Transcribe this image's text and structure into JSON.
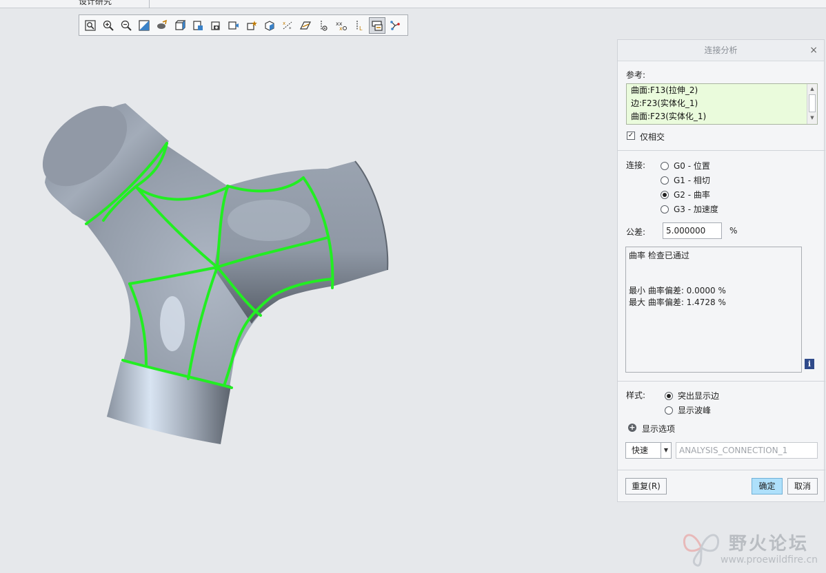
{
  "top_tab": {
    "label": "设计研究"
  },
  "toolbar": {
    "icons": [
      "zoom-refit-icon",
      "zoom-in-icon",
      "zoom-out-icon",
      "repaint-icon",
      "saved-orientations-icon",
      "display-style-icon",
      "view-manager-icon",
      "perspective-view-icon",
      "annotation-display-icon",
      "datum-plane-display-icon",
      "datum-axis-display-icon",
      "point-display-icon",
      "csys-display-icon",
      "spin-center-icon",
      "model-tree-display-icon",
      "analysis-display-icon",
      "connection-display-icon"
    ],
    "active_index": 15
  },
  "dialog": {
    "title": "连接分析",
    "close_label": "×",
    "references_label": "参考:",
    "references": [
      "曲面:F13(拉伸_2)",
      "边:F23(实体化_1)",
      "曲面:F23(实体化_1)"
    ],
    "intersect_only_label": "仅相交",
    "intersect_only_checked": true,
    "connection_label": "连接:",
    "connection_options": [
      "G0 - 位置",
      "G1 - 相切",
      "G2 - 曲率",
      "G3 - 加速度"
    ],
    "connection_selected": 2,
    "tolerance_label": "公差:",
    "tolerance_value": "5.000000",
    "tolerance_unit": "%",
    "results": {
      "status": "曲率 检查已通过",
      "min": "最小 曲率偏差: 0.0000 %",
      "max": "最大 曲率偏差: 1.4728 %"
    },
    "info_label": "i",
    "style_label": "样式:",
    "style_options": [
      "突出显示边",
      "显示波峰"
    ],
    "style_selected": 0,
    "display_options_label": "显示选项",
    "mode_value": "快速",
    "analysis_name": "ANALYSIS_CONNECTION_1",
    "repeat_button": "重复(R)",
    "ok_button": "确定",
    "cancel_button": "取消"
  },
  "watermark": {
    "title": "野火论坛",
    "url": "www.proewildfire.cn"
  },
  "colors": {
    "accent_green": "#22ee22",
    "ok_button": "#aee0fb",
    "reference_box": "#eafbdc"
  }
}
